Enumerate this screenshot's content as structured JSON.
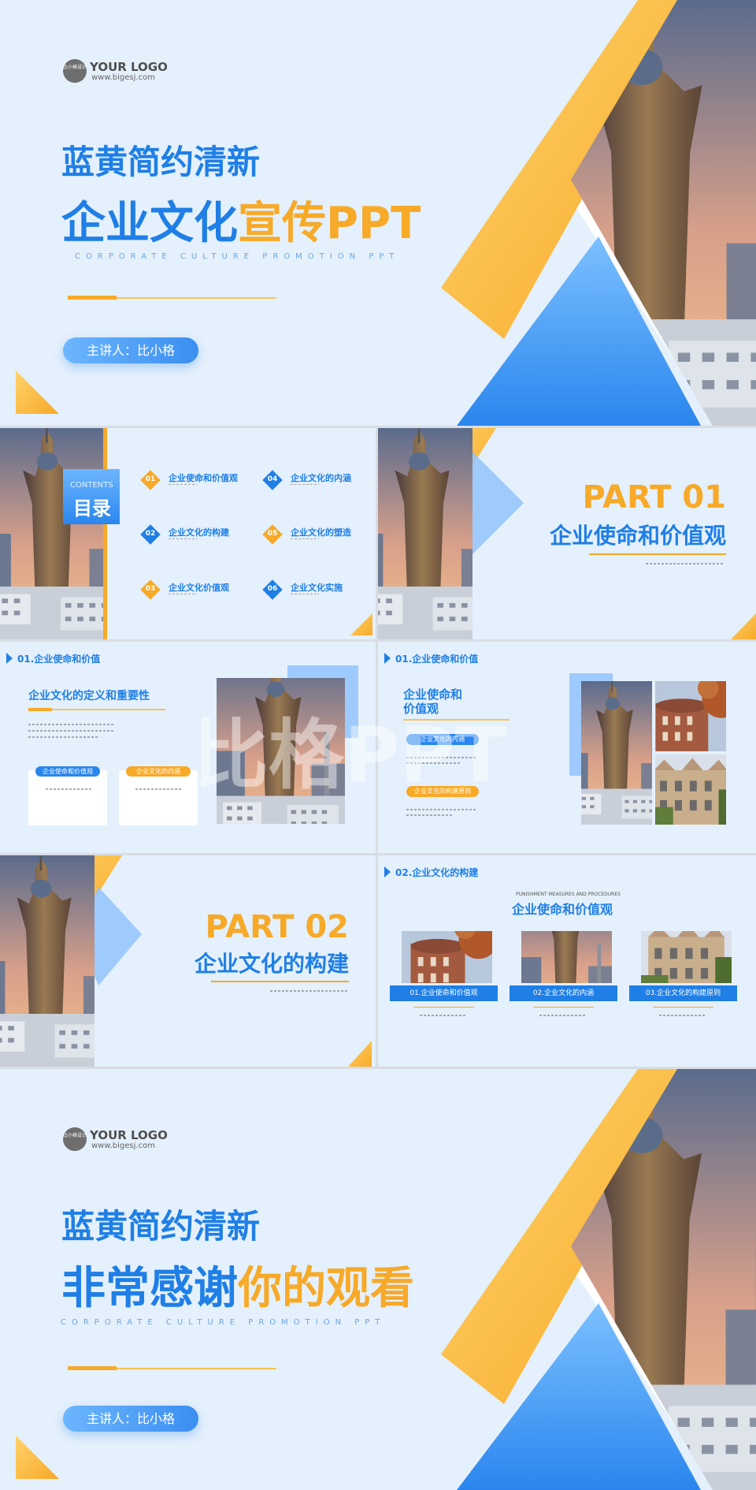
{
  "cover": {
    "logo_circle_text": "比小格设计",
    "logo_text": "YOUR LOGO",
    "logo_url": "www.bigesj.com",
    "subtitle": "蓝黄简约清新",
    "title_blue": "企业文化",
    "title_orange": "宣传PPT",
    "en_tagline": "CORPORATE CULTURE PROMOTION PPT",
    "presenter": "主讲人：比小格"
  },
  "toc": {
    "contents_en": "CONTENTS",
    "contents_cn": "目录",
    "items": [
      {
        "num": "01",
        "label": "企业使命和价值观",
        "color": "orange"
      },
      {
        "num": "02",
        "label": "企业文化的构建",
        "color": "blue"
      },
      {
        "num": "03",
        "label": "企业文化价值观",
        "color": "orange"
      },
      {
        "num": "04",
        "label": "企业文化的内涵",
        "color": "blue"
      },
      {
        "num": "05",
        "label": "企业文化的塑造",
        "color": "orange"
      },
      {
        "num": "06",
        "label": "企业文化实施",
        "color": "blue"
      }
    ]
  },
  "part01": {
    "part": "PART 01",
    "title": "企业使命和价值观"
  },
  "slide4": {
    "section": "01.企业使命和价值",
    "heading": "企业文化的定义和重要性",
    "tag1": "企业使命和价值观",
    "tag2": "企业文化的内涵"
  },
  "slide5": {
    "section": "01.企业使命和价值",
    "heading_line1": "企业使命和",
    "heading_line2": "价值观",
    "tag1": "企业文化的内涵",
    "tag2": "企业文化的构建原则"
  },
  "part02": {
    "part": "PART 02",
    "title": "企业文化的构建"
  },
  "slide7": {
    "section": "02.企业文化的构建",
    "small_en": "PUNISHMENT MEASURES AND PROCEDURES",
    "heading": "企业使命和价值观",
    "cards": [
      "01.企业使命和价值观",
      "02.企业文化的内涵",
      "03.企业文化的构建原则"
    ]
  },
  "ending": {
    "logo_circle_text": "比小格设计",
    "logo_text": "YOUR LOGO",
    "logo_url": "www.bigesj.com",
    "subtitle": "蓝黄简约清新",
    "title_blue": "非常感谢",
    "title_orange": "你的观看",
    "en_tagline": "CORPORATE CULTURE PROMOTION PPT",
    "presenter": "主讲人：比小格"
  },
  "watermark": "比格PPT",
  "colors": {
    "blue": "#1f7fe6",
    "orange": "#f7a928",
    "background": "#e4f0fb"
  }
}
